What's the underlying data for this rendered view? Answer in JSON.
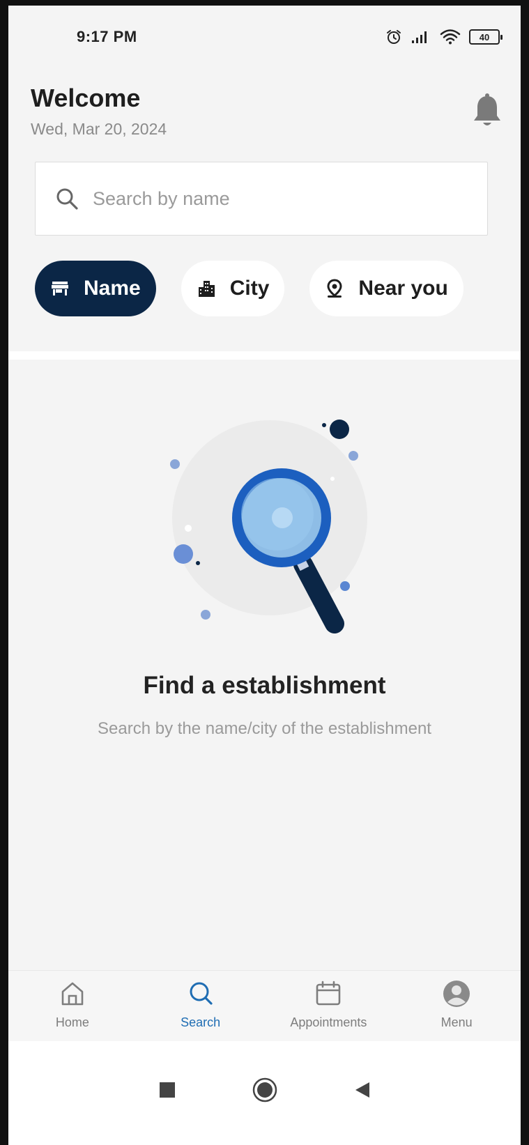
{
  "status_bar": {
    "time": "9:17 PM",
    "battery": "40",
    "icons": [
      "alarm-icon",
      "signal-icon",
      "wifi-icon",
      "battery-icon"
    ]
  },
  "header": {
    "title": "Welcome",
    "date": "Wed, Mar 20, 2024",
    "notification_icon": "bell-icon"
  },
  "search": {
    "placeholder": "Search by name",
    "value": ""
  },
  "filters": {
    "items": [
      {
        "label": "Name",
        "icon": "store-icon",
        "active": true
      },
      {
        "label": "City",
        "icon": "city-icon",
        "active": false
      },
      {
        "label": "Near you",
        "icon": "location-pin-icon",
        "active": false
      }
    ]
  },
  "empty_state": {
    "title": "Find a establishment",
    "subtitle": "Search by the name/city of the establishment",
    "illustration": "magnifier-illustration"
  },
  "bottom_nav": {
    "items": [
      {
        "label": "Home",
        "icon": "home-icon",
        "active": false
      },
      {
        "label": "Search",
        "icon": "search-icon",
        "active": true
      },
      {
        "label": "Appointments",
        "icon": "calendar-icon",
        "active": false
      },
      {
        "label": "Menu",
        "icon": "profile-icon",
        "active": false
      }
    ]
  },
  "system_nav": {
    "items": [
      "recents-button",
      "home-button",
      "back-button"
    ]
  },
  "colors": {
    "primary": "#0b2646",
    "accent": "#1f6db3",
    "background": "#f4f4f4",
    "muted_text": "#9a9a9a"
  }
}
